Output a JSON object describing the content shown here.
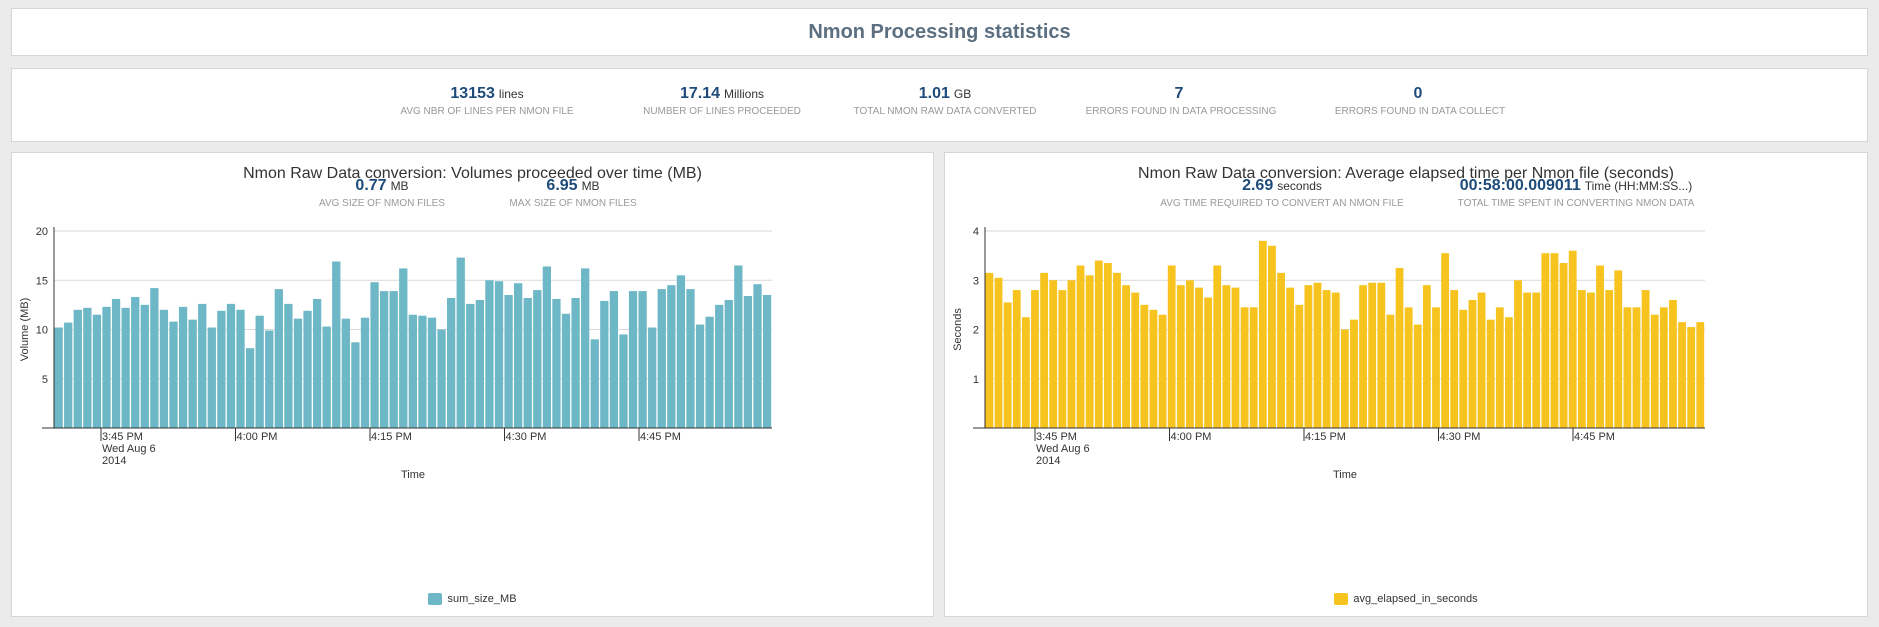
{
  "page": {
    "title": "Nmon Processing statistics"
  },
  "stats": [
    {
      "value": "13153",
      "unit": "lines",
      "label": "AVG NBR OF LINES PER NMON FILE"
    },
    {
      "value": "17.14",
      "unit": "Millions",
      "label": "NUMBER OF LINES PROCEEDED"
    },
    {
      "value": "1.01",
      "unit": "GB",
      "label": "TOTAL NMON RAW DATA CONVERTED"
    },
    {
      "value": "7",
      "unit": "",
      "label": "ERRORS FOUND IN DATA PROCESSING"
    },
    {
      "value": "0",
      "unit": "",
      "label": "ERRORS FOUND IN DATA COLLECT"
    }
  ],
  "panels": [
    {
      "title": "Nmon Raw Data conversion: Volumes proceeded over time (MB)",
      "stats": [
        {
          "value": "0.77",
          "unit": "MB",
          "label": "AVG SIZE OF NMON FILES"
        },
        {
          "value": "6.95",
          "unit": "MB",
          "label": "MAX SIZE OF NMON FILES"
        }
      ],
      "legend": "sum_size_MB"
    },
    {
      "title": "Nmon Raw Data conversion: Average elapsed time per Nmon file (seconds)",
      "stats": [
        {
          "value": "2.69",
          "unit": "seconds",
          "label": "AVG TIME REQUIRED TO CONVERT AN NMON FILE"
        },
        {
          "value": "00:58:00.009011",
          "unit": "Time (HH:MM:SS...)",
          "label": "TOTAL TIME SPENT IN CONVERTING NMON DATA"
        }
      ],
      "legend": "avg_elapsed_in_seconds"
    }
  ],
  "chart_data": [
    {
      "type": "bar",
      "series_name": "sum_size_MB",
      "color": "#6db7c7",
      "xlabel": "Time",
      "ylabel": "Volume (MB)",
      "ylim": [
        0,
        20
      ],
      "yticks": [
        5,
        10,
        15,
        20
      ],
      "xticks": [
        "3:45 PM",
        "4:00 PM",
        "4:15 PM",
        "4:30 PM",
        "4:45 PM"
      ],
      "xtick_first_extra": [
        "Wed Aug 6",
        "2014"
      ],
      "grid": true,
      "legend_position": "bottom",
      "values": [
        10.2,
        10.7,
        12.0,
        12.2,
        11.5,
        12.3,
        13.1,
        12.2,
        13.3,
        12.5,
        14.2,
        12.0,
        10.8,
        12.3,
        11.0,
        12.6,
        10.2,
        11.9,
        12.6,
        12.0,
        8.1,
        11.4,
        9.9,
        14.1,
        12.6,
        11.1,
        11.9,
        13.1,
        10.3,
        16.9,
        11.1,
        8.7,
        11.2,
        14.8,
        13.9,
        13.9,
        16.2,
        11.5,
        11.4,
        11.2,
        10.0,
        13.2,
        17.3,
        12.6,
        13.0,
        15.0,
        14.9,
        13.5,
        14.7,
        13.2,
        14.0,
        16.4,
        13.1,
        11.6,
        13.2,
        16.2,
        9.0,
        12.9,
        13.9,
        9.5,
        13.9,
        13.9,
        10.2,
        14.1,
        14.5,
        15.5,
        14.1,
        10.5,
        11.3,
        12.5,
        13.0,
        16.5,
        13.4,
        14.6,
        13.5
      ]
    },
    {
      "type": "bar",
      "series_name": "avg_elapsed_in_seconds",
      "color": "#f7c31f",
      "xlabel": "Time",
      "ylabel": "Seconds",
      "ylim": [
        0,
        4
      ],
      "yticks": [
        1,
        2,
        3,
        4
      ],
      "xticks": [
        "3:45 PM",
        "4:00 PM",
        "4:15 PM",
        "4:30 PM",
        "4:45 PM"
      ],
      "xtick_first_extra": [
        "Wed Aug 6",
        "2014"
      ],
      "grid": true,
      "legend_position": "bottom",
      "values": [
        3.15,
        3.05,
        2.55,
        2.8,
        2.25,
        2.8,
        3.15,
        3.0,
        2.8,
        3.0,
        3.3,
        3.1,
        3.4,
        3.35,
        3.15,
        2.9,
        2.75,
        2.5,
        2.4,
        2.3,
        3.3,
        2.9,
        3.0,
        2.85,
        2.65,
        3.3,
        2.9,
        2.85,
        2.45,
        2.45,
        3.8,
        3.7,
        3.15,
        2.85,
        2.5,
        2.9,
        2.95,
        2.8,
        2.75,
        2.0,
        2.2,
        2.9,
        2.95,
        2.95,
        2.3,
        3.25,
        2.45,
        2.1,
        2.9,
        2.45,
        3.55,
        2.8,
        2.4,
        2.6,
        2.75,
        2.2,
        2.45,
        2.25,
        3.0,
        2.75,
        2.75,
        3.55,
        3.55,
        3.35,
        3.6,
        2.8,
        2.75,
        3.3,
        2.8,
        3.2,
        2.45,
        2.45,
        2.8,
        2.3,
        2.45,
        2.6,
        2.15,
        2.05,
        2.15
      ]
    }
  ]
}
